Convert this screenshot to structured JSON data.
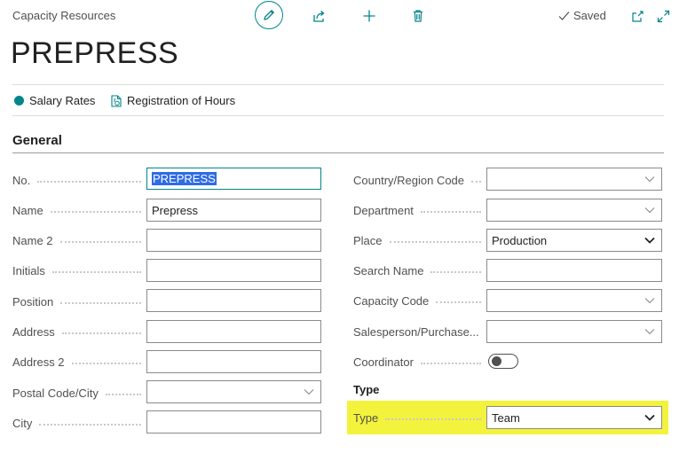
{
  "breadcrumb": "Capacity Resources",
  "toolbar": {
    "edit_icon": "pencil-icon",
    "share_icon": "share-icon",
    "new_icon": "plus-icon",
    "delete_icon": "trash-icon",
    "status": "Saved",
    "popout_icon": "open-new-window-icon",
    "expand_icon": "expand-icon"
  },
  "title": "PREPRESS",
  "actions": [
    {
      "label": "Salary Rates",
      "icon": "dot-icon"
    },
    {
      "label": "Registration of Hours",
      "icon": "document-icon"
    }
  ],
  "section": "General",
  "left_fields": [
    {
      "label": "No.",
      "value": "PREPRESS",
      "selected": true,
      "type": "text"
    },
    {
      "label": "Name",
      "value": "Prepress",
      "type": "text"
    },
    {
      "label": "Name 2",
      "value": "",
      "type": "text"
    },
    {
      "label": "Initials",
      "value": "",
      "type": "text"
    },
    {
      "label": "Position",
      "value": "",
      "type": "text"
    },
    {
      "label": "Address",
      "value": "",
      "type": "text"
    },
    {
      "label": "Address 2",
      "value": "",
      "type": "text"
    },
    {
      "label": "Postal Code/City",
      "value": "",
      "type": "lookup"
    },
    {
      "label": "City",
      "value": "",
      "type": "text"
    }
  ],
  "right_fields": [
    {
      "label": "Country/Region Code",
      "value": "",
      "type": "lookup"
    },
    {
      "label": "Department",
      "value": "",
      "type": "lookup"
    },
    {
      "label": "Place",
      "value": "Production",
      "type": "select"
    },
    {
      "label": "Search Name",
      "value": "",
      "type": "text"
    },
    {
      "label": "Capacity Code",
      "value": "",
      "type": "lookup"
    },
    {
      "label": "Salesperson/Purchase...",
      "value": "",
      "type": "lookup"
    },
    {
      "label": "Coordinator",
      "value": "off",
      "type": "toggle"
    }
  ],
  "type_group": {
    "heading": "Type",
    "label": "Type",
    "value": "Team"
  },
  "colors": {
    "accent": "#00858a",
    "highlight": "#f3f33d",
    "selection": "#2f6ce5"
  }
}
